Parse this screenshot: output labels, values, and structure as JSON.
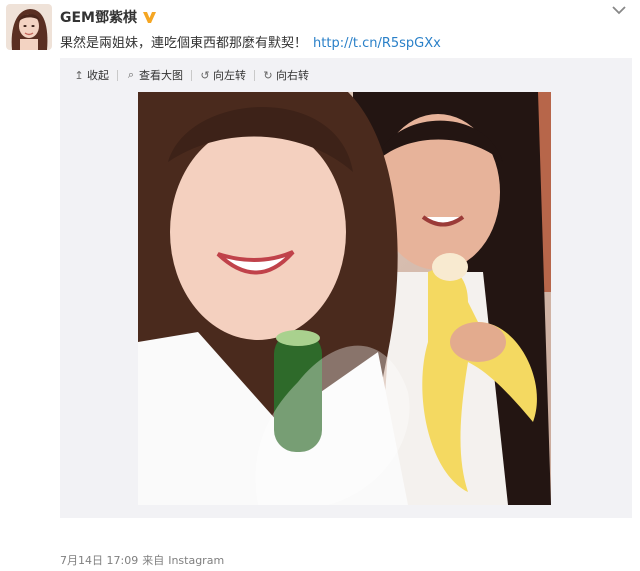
{
  "user": {
    "name": "GEM鄧紫棋",
    "verified_color": "#f5a623"
  },
  "post": {
    "text": "果然是兩姐妹，連吃個東西都那麼有默契！",
    "link": "http://t.cn/R5spGXx"
  },
  "toolbar": {
    "items": [
      {
        "label": "收起",
        "icon": "collapse-arrow-icon"
      },
      {
        "label": "查看大图",
        "icon": "magnifier-icon"
      },
      {
        "label": "向左转",
        "icon": "rotate-left-icon"
      },
      {
        "label": "向右转",
        "icon": "rotate-right-icon"
      }
    ]
  },
  "meta": {
    "date": "7月14日 17:09",
    "from_label": "来自",
    "source": "Instagram"
  },
  "colors": {
    "link": "#2a80c8",
    "media_background": "#f2f2f5",
    "meta_text": "#808080"
  }
}
